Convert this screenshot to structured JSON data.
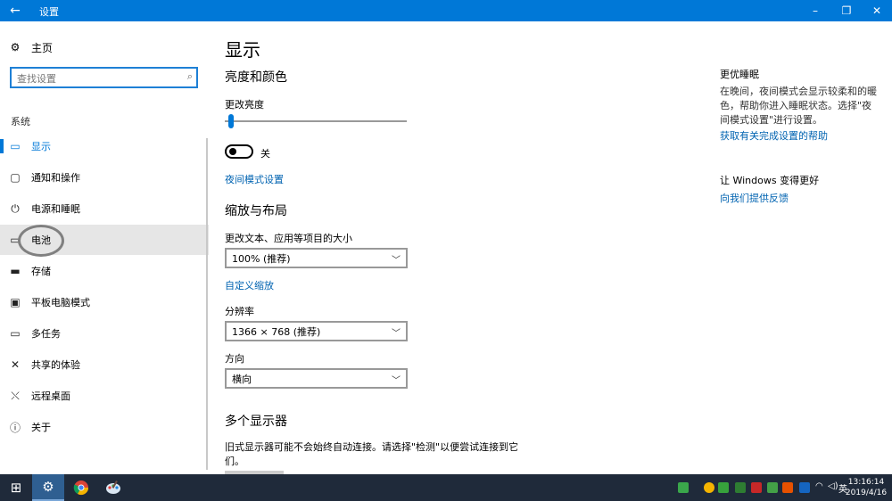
{
  "window": {
    "title": "设置",
    "back_icon": "←",
    "minimize_icon": "–",
    "restore_icon": "❐",
    "close_icon": "✕"
  },
  "sidebar": {
    "home": {
      "label": "主页",
      "icon": "gear-icon"
    },
    "search": {
      "placeholder": "查找设置"
    },
    "group": "系统",
    "items": [
      {
        "label": "显示",
        "icon": "monitor-icon",
        "glyph": "▭",
        "selected": true
      },
      {
        "label": "通知和操作",
        "icon": "notification-icon",
        "glyph": "▢"
      },
      {
        "label": "电源和睡眠",
        "icon": "power-icon",
        "glyph": "⏻"
      },
      {
        "label": "电池",
        "icon": "battery-icon",
        "glyph": "▭",
        "hover": true
      },
      {
        "label": "存储",
        "icon": "storage-icon",
        "glyph": "▬"
      },
      {
        "label": "平板电脑模式",
        "icon": "tablet-icon",
        "glyph": "▣"
      },
      {
        "label": "多任务",
        "icon": "multitask-icon",
        "glyph": "▭"
      },
      {
        "label": "共享的体验",
        "icon": "shared-icon",
        "glyph": "✕"
      },
      {
        "label": "远程桌面",
        "icon": "remote-icon",
        "glyph": "⤬"
      },
      {
        "label": "关于",
        "icon": "info-icon",
        "glyph": "ⓘ"
      }
    ]
  },
  "main": {
    "title": "显示",
    "brightness": {
      "section": "亮度和颜色",
      "label": "更改亮度",
      "level": 0.02,
      "night_light_state": "关",
      "night_light_link": "夜间模式设置"
    },
    "scale": {
      "section": "缩放与布局",
      "text_size_label": "更改文本、应用等项目的大小",
      "text_size_value": "100% (推荐)",
      "custom_link": "自定义缩放",
      "resolution_label": "分辨率",
      "resolution_value": "1366 × 768 (推荐)",
      "orientation_label": "方向",
      "orientation_value": "横向"
    },
    "multi": {
      "section": "多个显示器",
      "text": "旧式显示器可能不会始终自动连接。请选择\"检测\"以便尝试连接到它们。"
    }
  },
  "right": {
    "sleep_title": "更优睡眠",
    "sleep_text": "在晚间，夜间模式会显示较柔和的暖色，帮助你进入睡眠状态。选择\"夜间模式设置\"进行设置。",
    "sleep_link": "获取有关完成设置的帮助",
    "improve_title": "让 Windows 变得更好",
    "feedback_link": "向我们提供反馈"
  },
  "taskbar": {
    "clock_time": "13:16:14",
    "clock_date": "2019/4/16",
    "ime": "英"
  }
}
